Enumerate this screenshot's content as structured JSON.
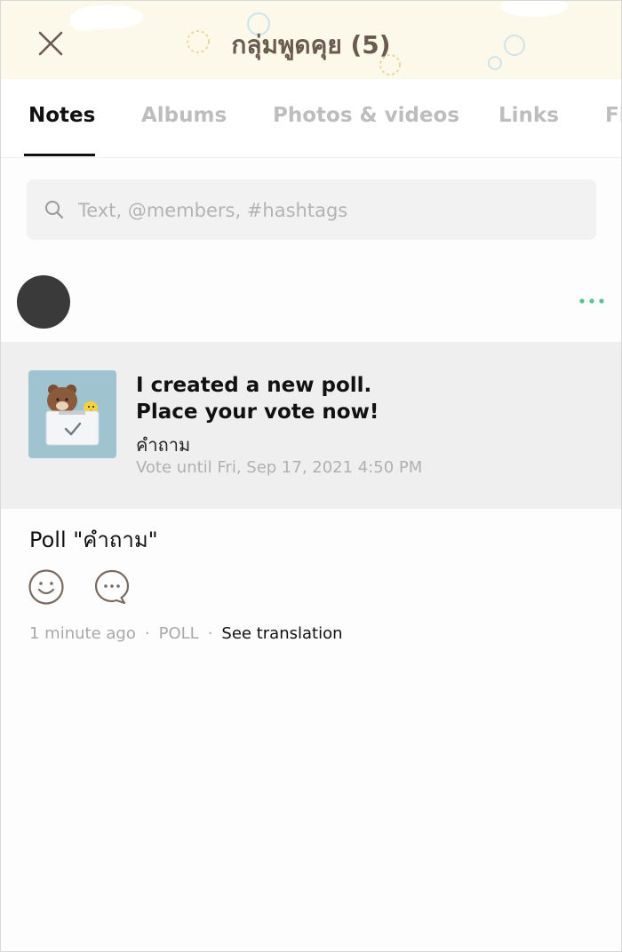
{
  "header": {
    "title": "กลุ่มพูดคุย (5)"
  },
  "tabs": [
    {
      "label": "Notes",
      "active": true
    },
    {
      "label": "Albums",
      "active": false
    },
    {
      "label": "Photos & videos",
      "active": false
    },
    {
      "label": "Links",
      "active": false
    },
    {
      "label": "Fi",
      "active": false
    }
  ],
  "search": {
    "placeholder": "Text, @members, #hashtags",
    "value": ""
  },
  "post": {
    "poll_card": {
      "heading_line1": "I created a new poll.",
      "heading_line2": "Place your vote now!",
      "question": "คำถาม",
      "deadline": "Vote until Fri, Sep 17, 2021 4:50 PM"
    },
    "text": "Poll \"คำถาม\"",
    "meta": {
      "time": "1 minute ago",
      "type": "POLL",
      "translate_label": "See translation"
    }
  },
  "icons": {
    "close": "close-icon",
    "search": "search-icon",
    "more": "more-dots-icon",
    "reaction": "smiley-icon",
    "comment": "comment-icon"
  },
  "colors": {
    "header_bg": "#fcf8ea",
    "title": "#6b5a4e",
    "more_dots": "#5cc48a",
    "poll_bg": "#efefef",
    "thumb_bg": "#9fc3cf"
  }
}
